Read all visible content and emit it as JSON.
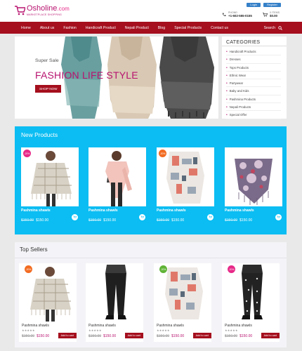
{
  "header": {
    "logo_name": "Osholine",
    "logo_domain": ".com",
    "logo_tagline": "Marketplace Shopping",
    "login_label": "Login",
    "register_label": "Register",
    "phone_label": "PHONE:",
    "phone_number": "+1-602-555-0155",
    "cart_items": "0 ITEMS",
    "cart_total": "$0.00"
  },
  "nav": {
    "items": [
      "Home",
      "About us",
      "Fashion",
      "Handicraft Product",
      "Nepali Product",
      "Blog",
      "Special Products",
      "Contact us"
    ],
    "search_label": "Search"
  },
  "hero": {
    "subtitle": "Super Sale",
    "title": "FASHION LIFE STYLE",
    "button_label": "SHOP NOW"
  },
  "categories": {
    "title": "CATEGORIES",
    "items": [
      "Handicraft Products",
      "Dresses",
      "Tops Products",
      "Ethnic Wear",
      "Partywear",
      "Baby and Kids",
      "Pashmina Products",
      "Nepali Products",
      "Special Offer"
    ]
  },
  "new_products": {
    "title": "New Products",
    "items": [
      {
        "name": "Pashmina shawls",
        "old_price": "$150.00",
        "price": "$150.00",
        "badge": "-20%"
      },
      {
        "name": "Pashmina shawls",
        "old_price": "$150.00",
        "price": "$150.00",
        "badge": ""
      },
      {
        "name": "Pashmina shawls",
        "old_price": "$150.00",
        "price": "$150.00",
        "badge": "-20%"
      },
      {
        "name": "Pashmina shawls",
        "old_price": "$150.00",
        "price": "$150.00",
        "badge": ""
      }
    ]
  },
  "top_sellers": {
    "title": "Top Sellers",
    "add_label": "Add to cart",
    "stars": "★★★★★",
    "items": [
      {
        "name": "Pashmina shawls",
        "old_price": "$150.00",
        "price": "$150.00",
        "badge": "-20%"
      },
      {
        "name": "Pashmina shawls",
        "old_price": "$150.00",
        "price": "$150.00",
        "badge": ""
      },
      {
        "name": "Pashmina shawls",
        "old_price": "$150.00",
        "price": "$150.00",
        "badge": "-20%"
      },
      {
        "name": "Pashmina shawls",
        "old_price": "$150.00",
        "price": "$150.00",
        "badge": "-20%"
      }
    ]
  },
  "colors": {
    "brand_magenta": "#b8136f",
    "nav_red": "#a50f1e",
    "new_products_blue": "#0bbdf2",
    "badge_pink": "#e72988",
    "badge_orange": "#f26b21",
    "badge_green": "#5fb336"
  }
}
